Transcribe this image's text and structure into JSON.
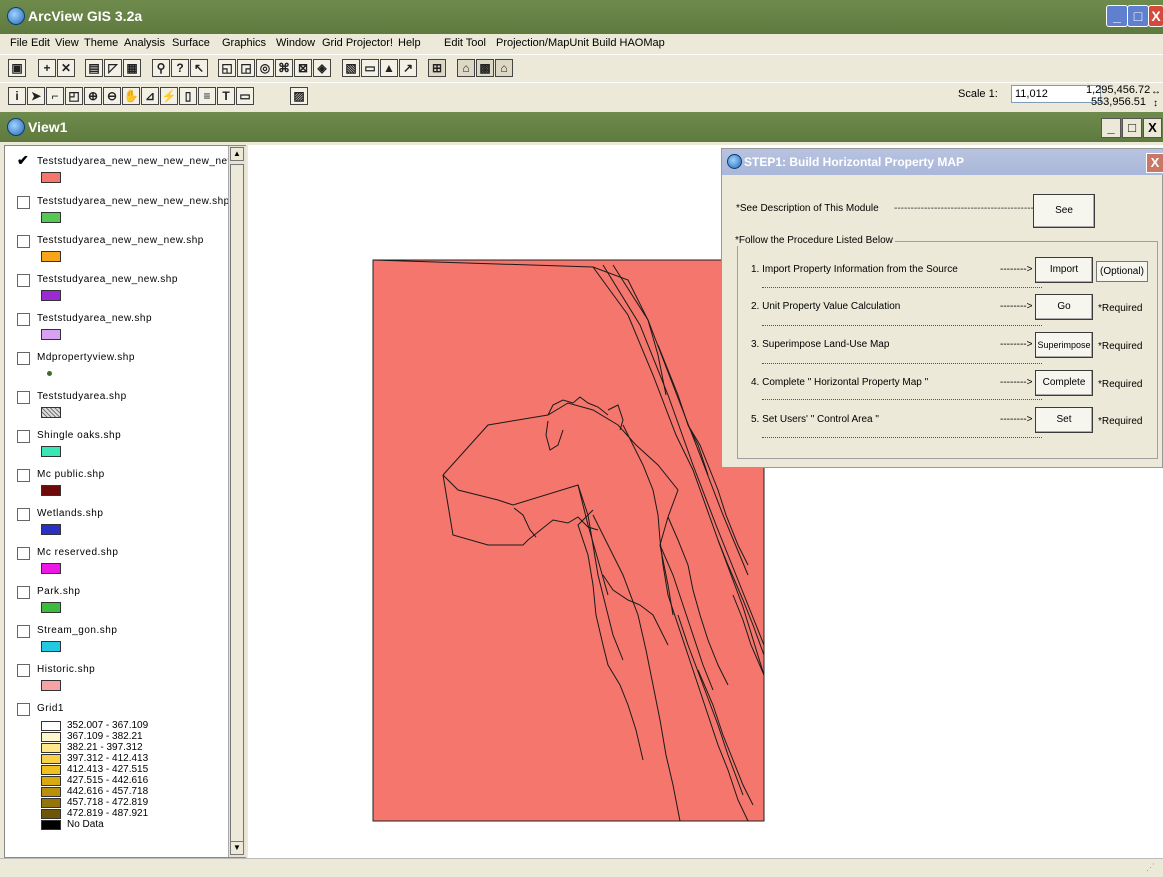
{
  "app": {
    "title": "ArcView GIS 3.2a",
    "window_controls": {
      "minimize": "_",
      "maximize": "□",
      "close": "X"
    }
  },
  "menu": [
    "File",
    "Edit",
    "View",
    "Theme",
    "Analysis",
    "Surface",
    "Graphics",
    "Window",
    "Grid Projector!",
    "Help",
    "Edit Tool",
    "Projection/MapUnit",
    "Build HAOMap"
  ],
  "scale": {
    "label": "Scale 1:",
    "value": "11,012"
  },
  "coords": {
    "x": "1,295,456.72",
    "y": "553,956.51"
  },
  "view": {
    "title": "View1"
  },
  "toc": {
    "layers": [
      {
        "name": "Teststudyarea_new_new_new_new_new.",
        "checked": true,
        "color": "#f4766c"
      },
      {
        "name": "Teststudyarea_new_new_new_new.shp",
        "checked": false,
        "color": "#55c854"
      },
      {
        "name": "Teststudyarea_new_new_new.shp",
        "checked": false,
        "color": "#f6a419"
      },
      {
        "name": "Teststudyarea_new_new.shp",
        "checked": false,
        "color": "#9a2bd4"
      },
      {
        "name": "Teststudyarea_new.shp",
        "checked": false,
        "color": "#d8a2f2"
      },
      {
        "name": "Mdpropertyview.shp",
        "checked": false,
        "color": "dot"
      },
      {
        "name": "Teststudyarea.shp",
        "checked": false,
        "color": "hatch"
      },
      {
        "name": "Shingle oaks.shp",
        "checked": false,
        "color": "#38e7b3"
      },
      {
        "name": "Mc public.shp",
        "checked": false,
        "color": "#6e0a0a"
      },
      {
        "name": "Wetlands.shp",
        "checked": false,
        "color": "#2a2fc6"
      },
      {
        "name": "Mc reserved.shp",
        "checked": false,
        "color": "#ec17e4"
      },
      {
        "name": "Park.shp",
        "checked": false,
        "color": "#3dbb3e"
      },
      {
        "name": "Stream_gon.shp",
        "checked": false,
        "color": "#22c9e3"
      },
      {
        "name": "Historic.shp",
        "checked": false,
        "color": "#f5a3a6"
      },
      {
        "name": "Grid1",
        "checked": false,
        "color": "none"
      }
    ],
    "grid_classes": [
      {
        "label": "352.007 - 367.109",
        "color": "#ffffff"
      },
      {
        "label": "367.109 - 382.21",
        "color": "#fff7cc"
      },
      {
        "label": "382.21 - 397.312",
        "color": "#ffe78a"
      },
      {
        "label": "397.312 - 412.413",
        "color": "#f8d14a"
      },
      {
        "label": "412.413 - 427.515",
        "color": "#f0c020"
      },
      {
        "label": "427.515 - 442.616",
        "color": "#d9aa10"
      },
      {
        "label": "442.616 - 457.718",
        "color": "#b8900b"
      },
      {
        "label": "457.718 - 472.819",
        "color": "#957409"
      },
      {
        "label": "472.819 - 487.921",
        "color": "#6f5606"
      },
      {
        "label": "No Data",
        "color": "#000000"
      }
    ]
  },
  "dialog": {
    "title": "STEP1: Build Horizontal Property MAP",
    "close": "X",
    "desc_label": "*See Description of This Module",
    "desc_arrow": "--------------------------------------------->",
    "see_button": "See",
    "group_label": "*Follow the Procedure Listed Below",
    "steps": [
      {
        "label": "1. Import Property Information from the Source",
        "arrow": "-------->",
        "button": "Import",
        "note": "(Optional)"
      },
      {
        "label": "2. Unit Property Value Calculation",
        "arrow": "-------->",
        "button": "Go",
        "note": "*Required"
      },
      {
        "label": "3. Superimpose Land-Use Map",
        "arrow": "-------->",
        "button": "Superimpose",
        "note": "*Required"
      },
      {
        "label": "4. Complete \" Horizontal Property Map \"",
        "arrow": "-------->",
        "button": "Complete",
        "note": "*Required"
      },
      {
        "label": "5. Set Users' \" Control Area \"",
        "arrow": "-------->",
        "button": "Set",
        "note": "*Required"
      }
    ]
  },
  "colors": {
    "titlebar": "#647f44",
    "map_fill": "#f4766c"
  }
}
